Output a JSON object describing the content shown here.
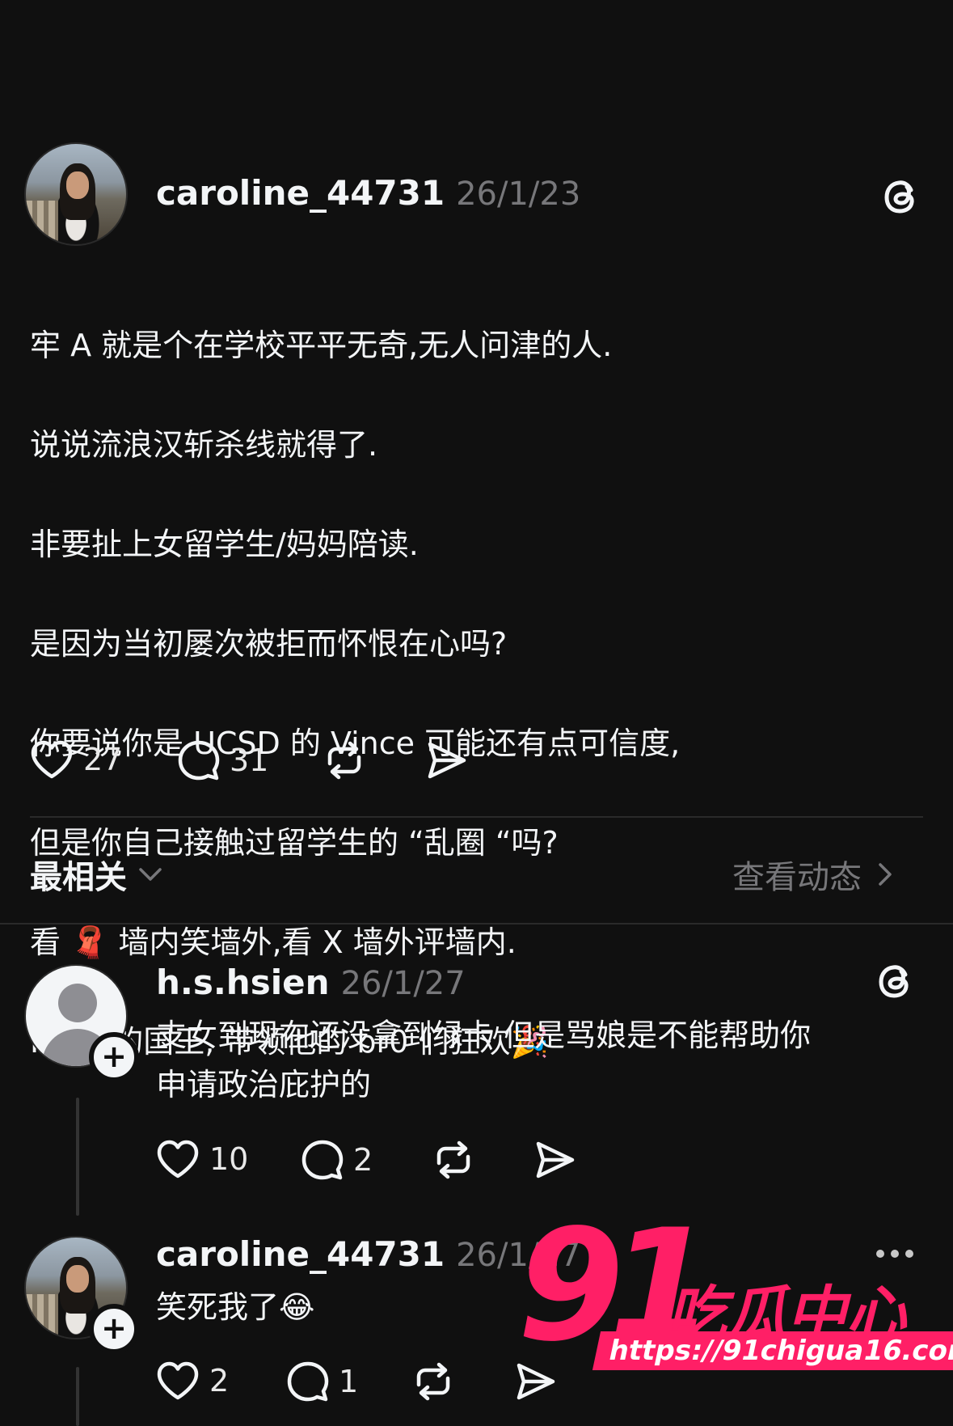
{
  "post": {
    "username": "caroline_44731",
    "date": "26/1/23",
    "text_lines": [
      "牢 A 就是个在学校平平无奇,无人问津的人.",
      "说说流浪汉斩杀线就得了.",
      "非要扯上女留学生/妈妈陪读.",
      "是因为当初屡次被拒而怀恨在心吗?",
      "你要说你是 UCSD 的 Vince 可能还有点可信度,",
      "但是你自己接触过留学生的 “乱圈 “吗?",
      "看 🧣 墙内笑墙外,看 X 墙外评墙内.",
      "Incel 的国王, 带领他的 br0 们狂欢🎉"
    ],
    "likes": "27",
    "comments": "31"
  },
  "sort_bar": {
    "sort_label": "最相关",
    "view_activity_label": "查看动态"
  },
  "replies": [
    {
      "username": "h.s.hsien",
      "date": "26/1/27",
      "text": "支女到现在还没拿到绿卡 但是骂娘是不能帮助你\n申请政治庇护的",
      "likes": "10",
      "comments": "2"
    },
    {
      "username": "caroline_44731",
      "date": "26/1/27",
      "text": "笑死我了😂",
      "likes": "2",
      "comments": "1"
    }
  ],
  "watermark": {
    "number": "91",
    "name": "吃瓜中心",
    "url": "https://91chigua16.com"
  },
  "icons": [
    "threads-logo-icon",
    "heart-icon",
    "comment-icon",
    "repost-icon",
    "share-icon",
    "chevron-down-icon",
    "chevron-right-icon",
    "more-icon"
  ],
  "colors": {
    "background": "#101010",
    "text": "#f3f5f7",
    "muted": "#77777a",
    "watermark": "#ff1f66"
  }
}
